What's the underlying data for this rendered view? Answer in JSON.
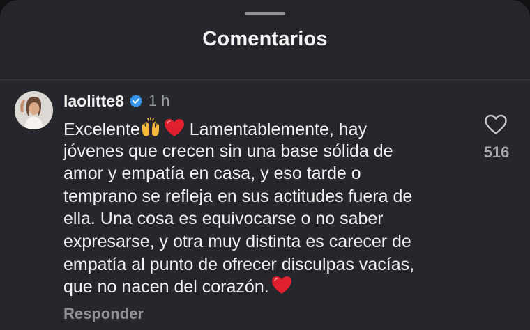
{
  "header": {
    "title": "Comentarios"
  },
  "comment": {
    "username": "laolitte8",
    "verified": true,
    "time": "1 h",
    "text_lines": [
      "Excelente",
      " Lamentablemente, hay",
      "jóvenes que crecen sin una base sólida de",
      "amor y empatía en casa, y eso tarde o",
      "temprano se refleja en sus actitudes fuera de",
      "ella. Una cosa es equivocarse o no saber",
      "expresarse, y otra muy distinta es carecer de",
      "empatía al punto de ofrecer disculpas vacías,",
      "que no nacen del corazón."
    ],
    "reply_label": "Responder",
    "like_count": "516"
  },
  "icons": {
    "raising_hands": "raising-hands-emoji",
    "heart_emoji": "red-heart-emoji",
    "verified": "verified-badge-icon",
    "like": "heart-outline-icon"
  },
  "colors": {
    "background": "#25272c",
    "text": "#f2f2f2",
    "muted": "#9a9ca3",
    "verified_blue": "#3797f0",
    "heart_red": "#e0202e"
  }
}
